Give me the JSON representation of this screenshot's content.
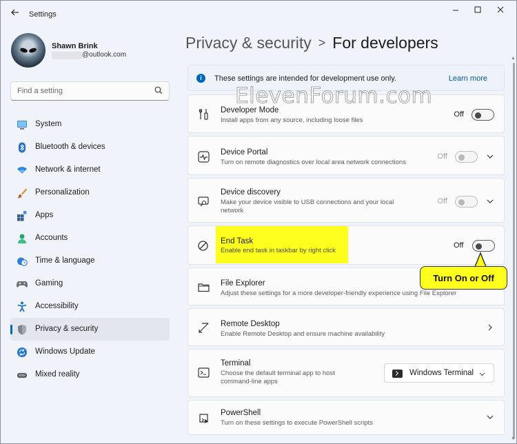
{
  "window": {
    "title": "Settings",
    "controls": [
      "minimize",
      "maximize",
      "close"
    ]
  },
  "user": {
    "name": "Shawn Brink",
    "email": "@outlook.com"
  },
  "search": {
    "placeholder": "Find a setting"
  },
  "nav": {
    "active": "Privacy & security",
    "items": [
      {
        "label": "System",
        "icon": "monitor-icon"
      },
      {
        "label": "Bluetooth & devices",
        "icon": "bluetooth-icon"
      },
      {
        "label": "Network & internet",
        "icon": "wifi-icon"
      },
      {
        "label": "Personalization",
        "icon": "brush-icon"
      },
      {
        "label": "Apps",
        "icon": "apps-icon"
      },
      {
        "label": "Accounts",
        "icon": "person-icon"
      },
      {
        "label": "Time & language",
        "icon": "clock-globe-icon"
      },
      {
        "label": "Gaming",
        "icon": "gamepad-icon"
      },
      {
        "label": "Accessibility",
        "icon": "accessibility-icon"
      },
      {
        "label": "Privacy & security",
        "icon": "shield-icon"
      },
      {
        "label": "Windows Update",
        "icon": "update-icon"
      },
      {
        "label": "Mixed reality",
        "icon": "headset-icon"
      }
    ]
  },
  "breadcrumb": {
    "parent": "Privacy & security",
    "separator": ">",
    "current": "For developers"
  },
  "info": {
    "text": "These settings are intended for development use only.",
    "link": "Learn more"
  },
  "settings": {
    "developer_mode": {
      "title": "Developer Mode",
      "desc": "Install apps from any source, including loose files",
      "state": "Off"
    },
    "device_portal": {
      "title": "Device Portal",
      "desc": "Turn on remote diagnostics over local area network connections",
      "state": "Off"
    },
    "device_discovery": {
      "title": "Device discovery",
      "desc": "Make your device visible to USB connections and your local network",
      "state": "Off"
    },
    "end_task": {
      "title": "End Task",
      "desc": "Enable end task in taskbar by right click",
      "state": "Off"
    },
    "file_explorer": {
      "title": "File Explorer",
      "desc": "Adjust these settings for a more developer-friendly experience using File Explorer"
    },
    "remote_desktop": {
      "title": "Remote Desktop",
      "desc": "Enable Remote Desktop and ensure machine availability"
    },
    "terminal": {
      "title": "Terminal",
      "desc": "Choose the default terminal app to host command-line apps",
      "value": "Windows Terminal"
    },
    "powershell": {
      "title": "PowerShell",
      "desc": "Turn on these settings to execute PowerShell scripts"
    }
  },
  "annotation": {
    "callout": "Turn On or Off",
    "highlight_color": "#ffff1e"
  },
  "watermark": "ElevenForum.com",
  "colors": {
    "accent": "#0067c0",
    "link": "#0558a6"
  }
}
